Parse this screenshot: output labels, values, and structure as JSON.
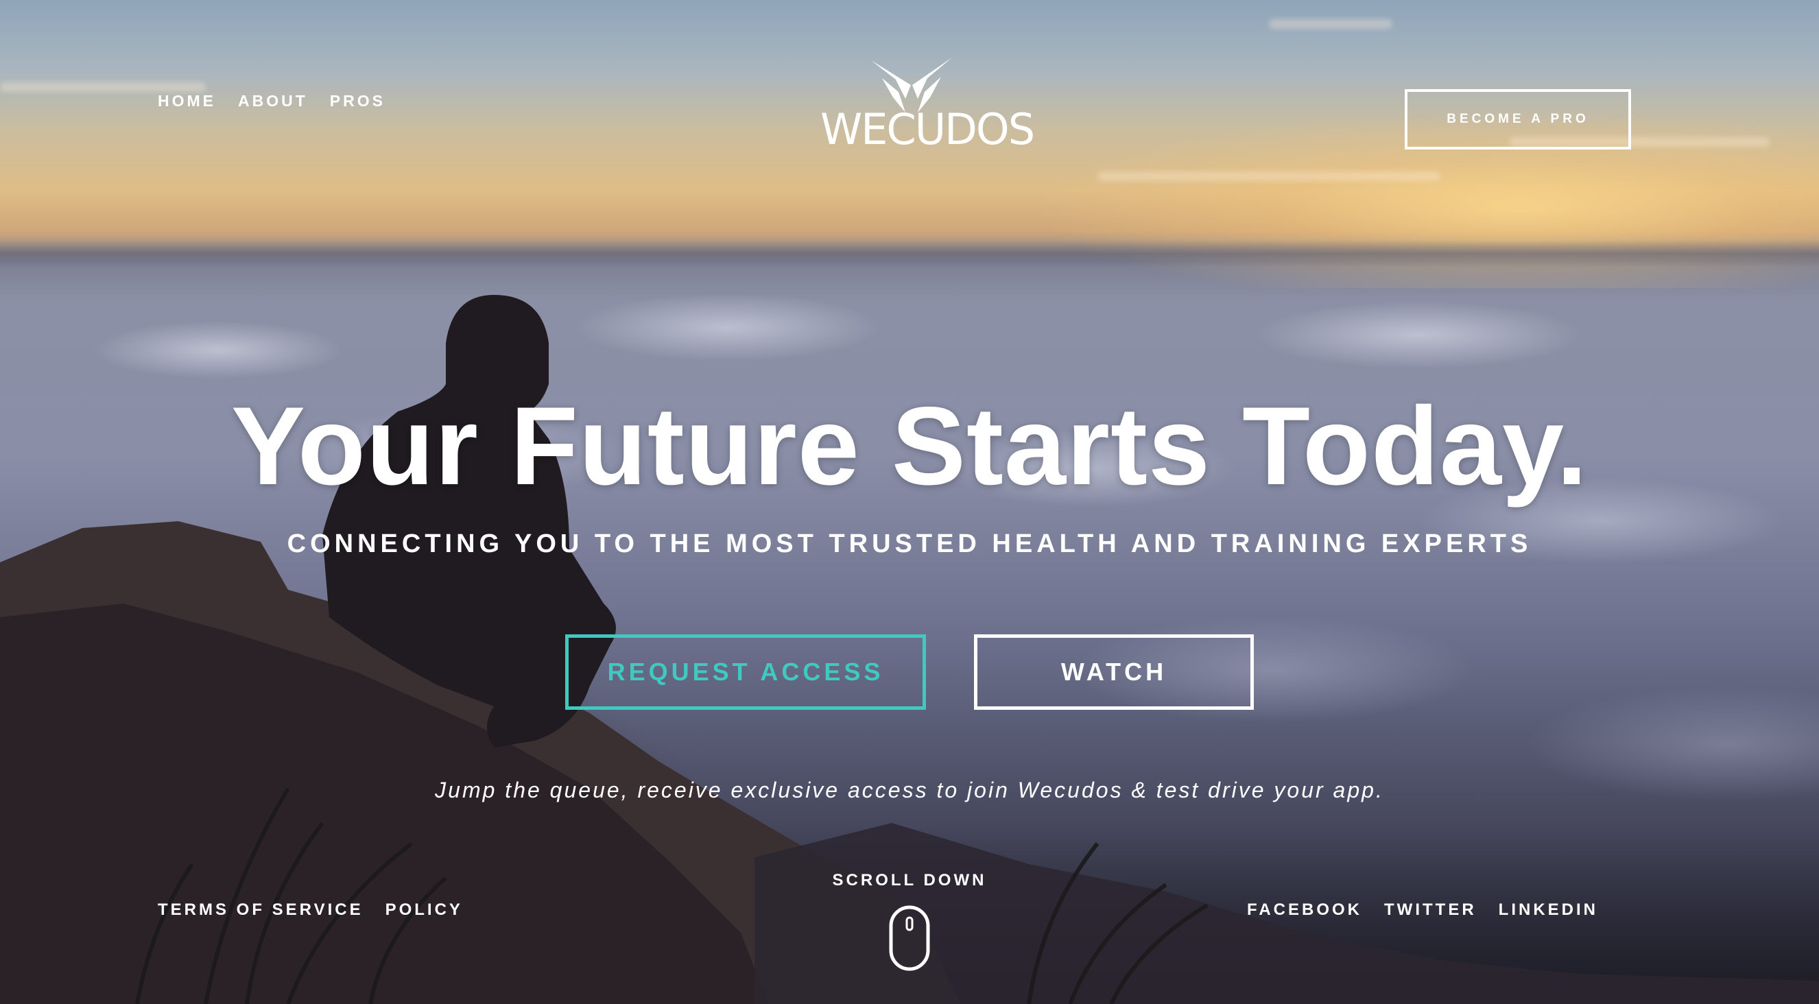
{
  "nav": {
    "home": "HOME",
    "about": "ABOUT",
    "pros": "PROS",
    "become_pro": "BECOME A PRO"
  },
  "logo": {
    "wordmark": "WECUDOS",
    "icon": "butterfly-w-logo-icon"
  },
  "hero": {
    "headline": "Your Future Starts Today.",
    "subheadline": "CONNECTING YOU TO THE MOST TRUSTED HEALTH AND TRAINING EXPERTS",
    "request_access": "REQUEST ACCESS",
    "watch": "WATCH",
    "tagline": "Jump the queue, receive exclusive access to join Wecudos & test drive your app."
  },
  "footer": {
    "terms": "TERMS OF SERVICE",
    "policy": "POLICY",
    "scroll_down": "SCROLL DOWN",
    "scroll_icon": "mouse-scroll-icon",
    "facebook": "FACEBOOK",
    "twitter": "TWITTER",
    "linkedin": "LINKEDIN"
  },
  "colors": {
    "accent": "#3fc9c0",
    "text": "#ffffff"
  }
}
